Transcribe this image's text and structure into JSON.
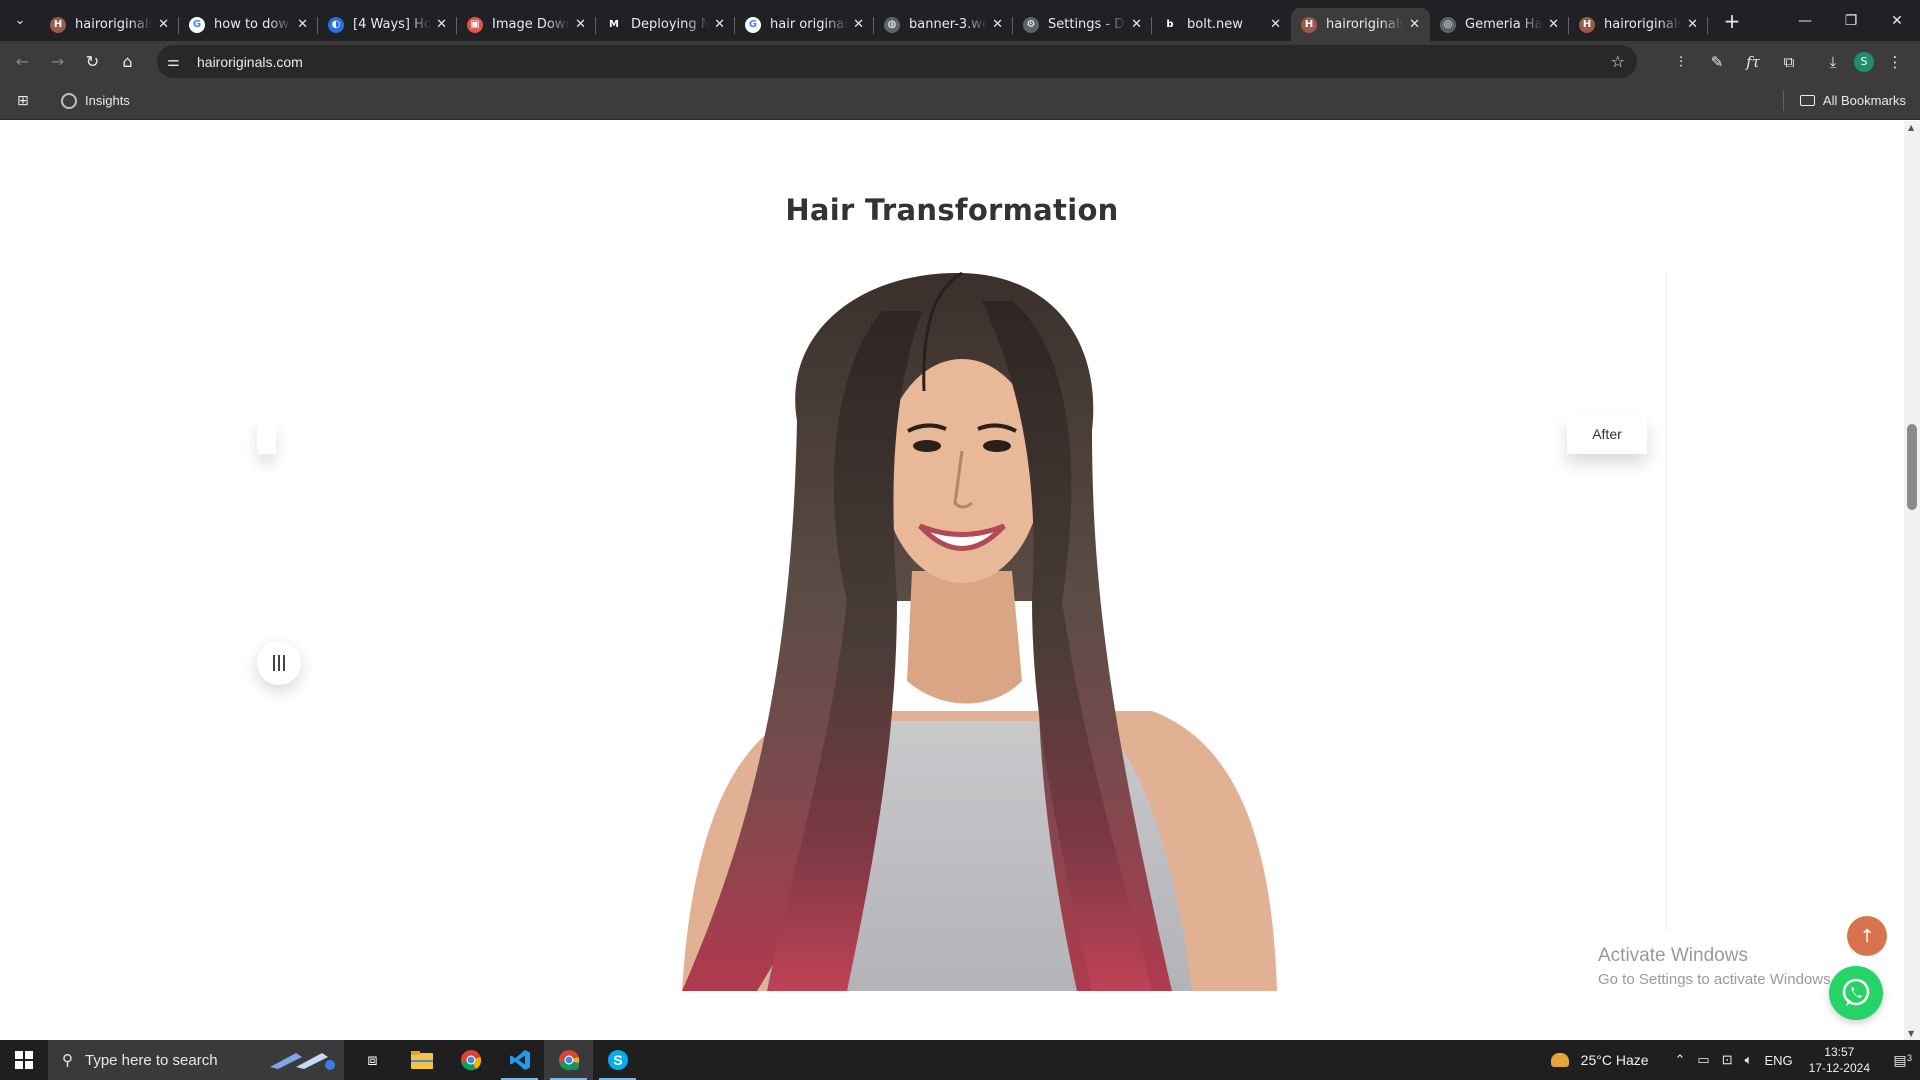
{
  "browser": {
    "tabs": [
      {
        "title": "hairoriginals.",
        "fav_color": "#9b5a4a",
        "fav_glyph": "H",
        "active": false
      },
      {
        "title": "how to down",
        "fav_color": "#ffffff",
        "fav_glyph": "G",
        "active": false
      },
      {
        "title": "[4 Ways] How",
        "fav_color": "#2b6fe0",
        "fav_glyph": "◐",
        "active": false
      },
      {
        "title": "Image Down",
        "fav_color": "#e4534a",
        "fav_glyph": "▣",
        "active": false
      },
      {
        "title": "Deploying N",
        "fav_color": "#202124",
        "fav_glyph": "M",
        "active": false
      },
      {
        "title": "hair original",
        "fav_color": "#ffffff",
        "fav_glyph": "G",
        "active": false
      },
      {
        "title": "banner-3.we",
        "fav_color": "#5f6368",
        "fav_glyph": "◍",
        "active": false
      },
      {
        "title": "Settings - D",
        "fav_color": "#5f6368",
        "fav_glyph": "⚙",
        "active": false
      },
      {
        "title": "bolt.new",
        "fav_color": "#202124",
        "fav_glyph": "b",
        "active": false
      },
      {
        "title": "hairoriginals.",
        "fav_color": "#9b5a4a",
        "fav_glyph": "H",
        "active": true
      },
      {
        "title": "Gemeria Hai",
        "fav_color": "#5f6368",
        "fav_glyph": "◎",
        "active": false
      },
      {
        "title": "hairoriginals.",
        "fav_color": "#9b5a4a",
        "fav_glyph": "H",
        "active": false
      }
    ],
    "url": "hairoriginals.com",
    "bookmarks": [
      {
        "label": "Insights"
      }
    ],
    "all_bookmarks_label": "All Bookmarks",
    "profile_initial": "S",
    "icons": {
      "tab_search": "chevron-down-icon",
      "new_tab": "plus-icon",
      "back": "arrow-left-icon",
      "forward": "arrow-right-icon",
      "reload": "reload-icon",
      "home": "home-icon",
      "site_info": "tune-icon",
      "bookmark_star": "star-icon",
      "extensions": [
        "performance-icon",
        "pen-icon",
        "formula-icon",
        "puzzle-icon",
        "download-icon"
      ],
      "menu": "kebab-menu-icon"
    }
  },
  "page": {
    "section_title": "Hair Transformation",
    "after_label": "After",
    "back_to_top_icon": "arrow-up-icon",
    "whatsapp_icon": "whatsapp-icon",
    "accent_color": "#d9734f",
    "whatsapp_color": "#25d366"
  },
  "watermark": {
    "line1": "Activate Windows",
    "line2": "Go to Settings to activate Windows."
  },
  "taskbar": {
    "search_placeholder": "Type here to search",
    "apps": [
      "task-view-icon",
      "file-explorer-icon",
      "chrome-icon",
      "vscode-icon",
      "chrome-profile-icon",
      "skype-icon"
    ],
    "weather": "25°C  Haze",
    "language": "ENG",
    "time": "13:57",
    "date": "17-12-2024",
    "notification_count": "3"
  }
}
